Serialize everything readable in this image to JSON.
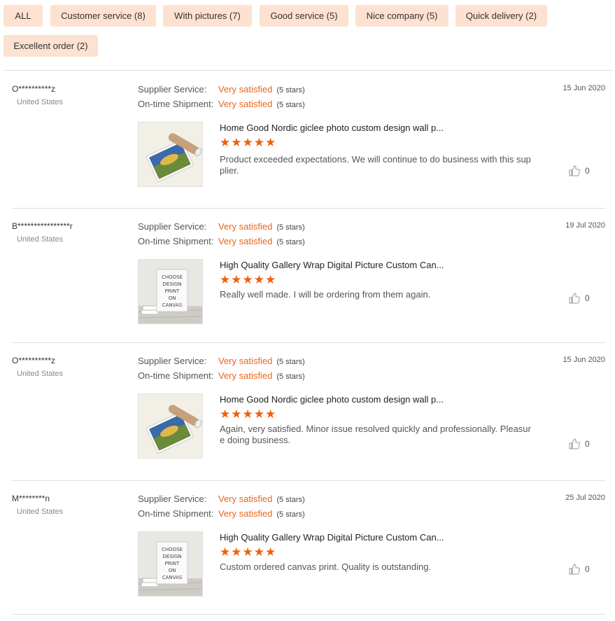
{
  "filters": [
    {
      "label": "ALL"
    },
    {
      "label": "Customer service (8)"
    },
    {
      "label": "With pictures (7)"
    },
    {
      "label": "Good service (5)"
    },
    {
      "label": "Nice company (5)"
    },
    {
      "label": "Quick delivery (2)"
    },
    {
      "label": "Excellent order (2)"
    }
  ],
  "labels": {
    "supplier_service": "Supplier Service:",
    "on_time_shipment": "On-time Shipment:"
  },
  "colors": {
    "accent": "#e8661b",
    "chip_bg": "#fde1d1",
    "star": "#ee5f10"
  },
  "reviews": [
    {
      "reviewer": "O**********z",
      "country": "United States",
      "date": "15 Jun 2020",
      "supplier_service": "Very satisfied",
      "supplier_stars": "(5 stars)",
      "shipment": "Very satisfied",
      "shipment_stars": "(5 stars)",
      "product": "Home Good Nordic giclee photo custom design wall p...",
      "product_image": "rolled-print-image",
      "rating": 5,
      "comment": "Product exceeded expectations. We will continue to do business with this supplier.",
      "likes": "0"
    },
    {
      "reviewer": "B****************r",
      "country": "United States",
      "date": "19 Jul 2020",
      "supplier_service": "Very satisfied",
      "supplier_stars": "(5 stars)",
      "shipment": "Very satisfied",
      "shipment_stars": "(5 stars)",
      "product": "High Quality Gallery Wrap Digital Picture Custom Can...",
      "product_image": "canvas-print-image",
      "rating": 5,
      "comment": "Really well made. I will be ordering from them again.",
      "likes": "0"
    },
    {
      "reviewer": "O**********z",
      "country": "United States",
      "date": "15 Jun 2020",
      "supplier_service": "Very satisfied",
      "supplier_stars": "(5 stars)",
      "shipment": "Very satisfied",
      "shipment_stars": "(5 stars)",
      "product": "Home Good Nordic giclee photo custom design wall p...",
      "product_image": "rolled-print-image",
      "rating": 5,
      "comment": "Again, very satisfied. Minor issue resolved quickly and professionally. Pleasure doing business.",
      "likes": "0"
    },
    {
      "reviewer": "M********n",
      "country": "United States",
      "date": "25 Jul 2020",
      "supplier_service": "Very satisfied",
      "supplier_stars": "(5 stars)",
      "shipment": "Very satisfied",
      "shipment_stars": "(5 stars)",
      "product": "High Quality Gallery Wrap Digital Picture Custom Can...",
      "product_image": "canvas-print-image",
      "rating": 5,
      "comment": "Custom ordered canvas print. Quality is outstanding.",
      "likes": "0"
    }
  ],
  "canvas_sign_text": [
    "CHOOSE",
    "DESIGN",
    "PRINT",
    "ON",
    "CANVAS"
  ]
}
